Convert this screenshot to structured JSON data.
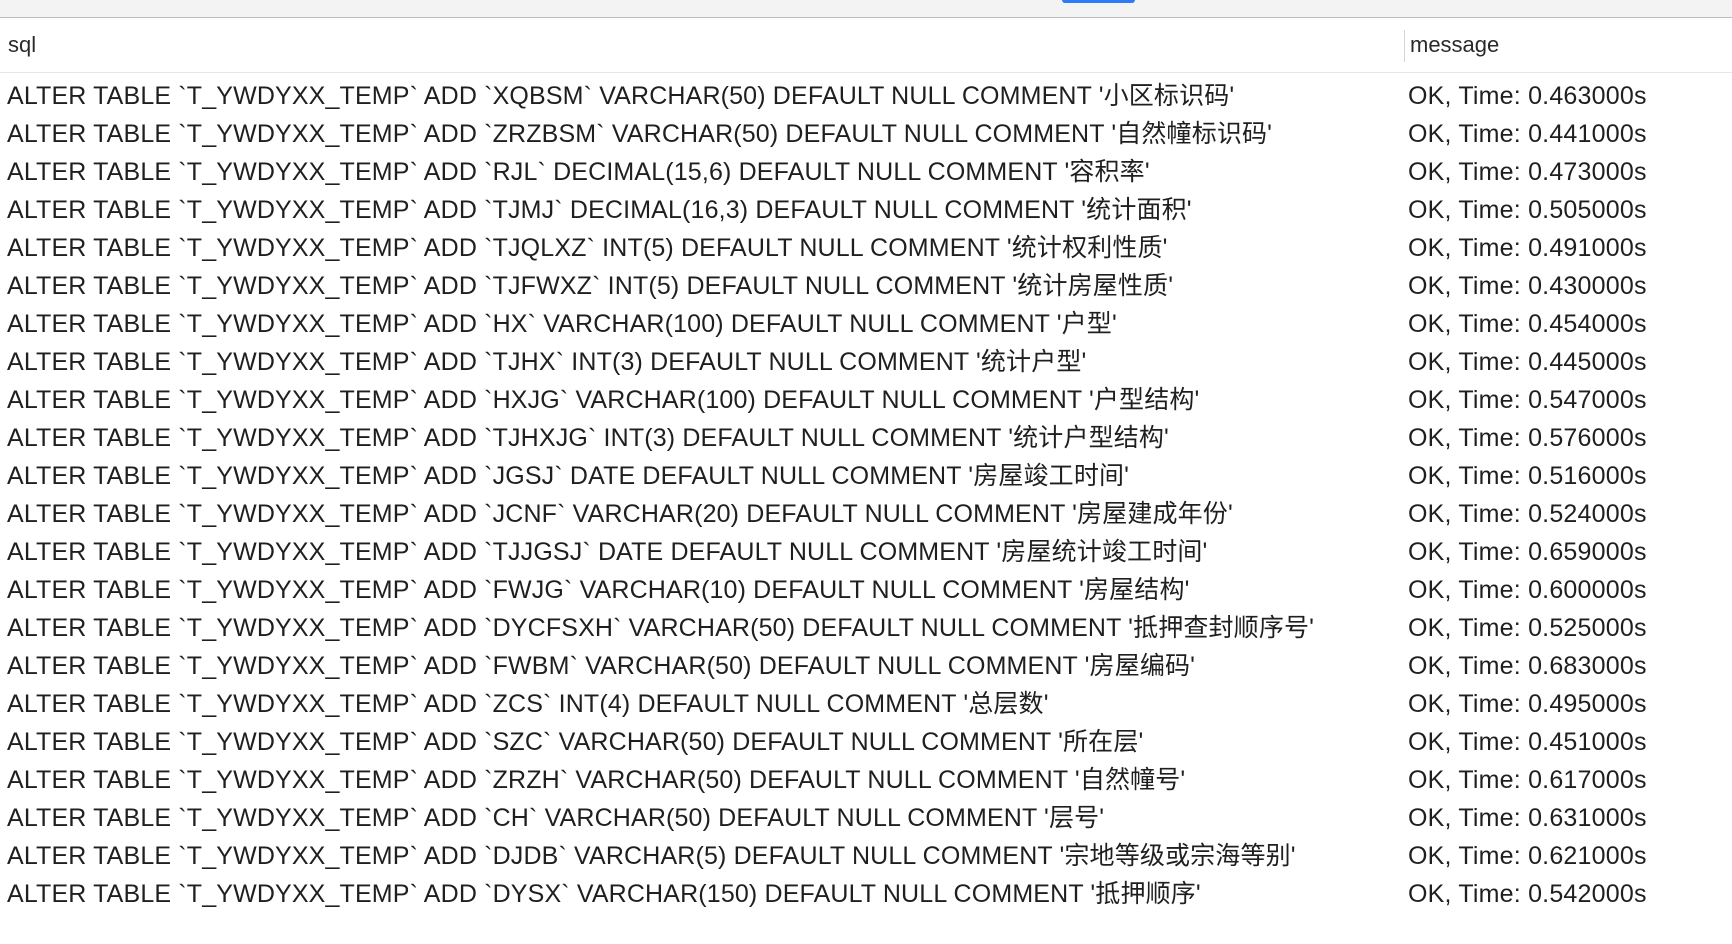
{
  "columns": {
    "sql": "sql",
    "message": "message"
  },
  "rows": [
    {
      "sql": "ALTER TABLE `T_YWDYXX_TEMP` ADD `XQBSM` VARCHAR(50) DEFAULT NULL COMMENT '小区标识码'",
      "message": "OK, Time: 0.463000s"
    },
    {
      "sql": "ALTER TABLE `T_YWDYXX_TEMP` ADD `ZRZBSM` VARCHAR(50) DEFAULT NULL COMMENT '自然幢标识码'",
      "message": "OK, Time: 0.441000s"
    },
    {
      "sql": "ALTER TABLE `T_YWDYXX_TEMP` ADD `RJL` DECIMAL(15,6) DEFAULT NULL COMMENT '容积率'",
      "message": "OK, Time: 0.473000s"
    },
    {
      "sql": "ALTER TABLE `T_YWDYXX_TEMP` ADD `TJMJ` DECIMAL(16,3) DEFAULT NULL COMMENT '统计面积'",
      "message": "OK, Time: 0.505000s"
    },
    {
      "sql": "ALTER TABLE `T_YWDYXX_TEMP` ADD `TJQLXZ` INT(5) DEFAULT NULL COMMENT '统计权利性质'",
      "message": "OK, Time: 0.491000s"
    },
    {
      "sql": "ALTER TABLE `T_YWDYXX_TEMP` ADD `TJFWXZ` INT(5) DEFAULT NULL COMMENT '统计房屋性质'",
      "message": "OK, Time: 0.430000s"
    },
    {
      "sql": "ALTER TABLE `T_YWDYXX_TEMP` ADD `HX` VARCHAR(100) DEFAULT NULL COMMENT '户型'",
      "message": "OK, Time: 0.454000s"
    },
    {
      "sql": "ALTER TABLE `T_YWDYXX_TEMP` ADD `TJHX` INT(3) DEFAULT NULL COMMENT '统计户型'",
      "message": "OK, Time: 0.445000s"
    },
    {
      "sql": "ALTER TABLE `T_YWDYXX_TEMP` ADD `HXJG` VARCHAR(100) DEFAULT NULL COMMENT '户型结构'",
      "message": "OK, Time: 0.547000s"
    },
    {
      "sql": "ALTER TABLE `T_YWDYXX_TEMP` ADD `TJHXJG` INT(3) DEFAULT NULL COMMENT '统计户型结构'",
      "message": "OK, Time: 0.576000s"
    },
    {
      "sql": "ALTER TABLE `T_YWDYXX_TEMP` ADD `JGSJ` DATE DEFAULT NULL COMMENT '房屋竣工时间'",
      "message": "OK, Time: 0.516000s"
    },
    {
      "sql": "ALTER TABLE `T_YWDYXX_TEMP` ADD `JCNF` VARCHAR(20) DEFAULT NULL COMMENT '房屋建成年份'",
      "message": "OK, Time: 0.524000s"
    },
    {
      "sql": "ALTER TABLE `T_YWDYXX_TEMP` ADD `TJJGSJ` DATE DEFAULT NULL COMMENT '房屋统计竣工时间'",
      "message": "OK, Time: 0.659000s"
    },
    {
      "sql": "ALTER TABLE `T_YWDYXX_TEMP` ADD `FWJG` VARCHAR(10) DEFAULT NULL COMMENT '房屋结构'",
      "message": "OK, Time: 0.600000s"
    },
    {
      "sql": "ALTER TABLE `T_YWDYXX_TEMP` ADD `DYCFSXH` VARCHAR(50) DEFAULT NULL COMMENT '抵押查封顺序号'",
      "message": "OK, Time: 0.525000s"
    },
    {
      "sql": "ALTER TABLE `T_YWDYXX_TEMP` ADD `FWBM` VARCHAR(50) DEFAULT NULL COMMENT '房屋编码'",
      "message": "OK, Time: 0.683000s"
    },
    {
      "sql": "ALTER TABLE `T_YWDYXX_TEMP` ADD `ZCS` INT(4) DEFAULT NULL COMMENT '总层数'",
      "message": "OK, Time: 0.495000s"
    },
    {
      "sql": "ALTER TABLE `T_YWDYXX_TEMP` ADD `SZC` VARCHAR(50) DEFAULT NULL COMMENT '所在层'",
      "message": "OK, Time: 0.451000s"
    },
    {
      "sql": "ALTER TABLE `T_YWDYXX_TEMP` ADD `ZRZH` VARCHAR(50) DEFAULT NULL COMMENT '自然幢号'",
      "message": "OK, Time: 0.617000s"
    },
    {
      "sql": "ALTER TABLE `T_YWDYXX_TEMP` ADD `CH` VARCHAR(50) DEFAULT NULL COMMENT '层号'",
      "message": "OK, Time: 0.631000s"
    },
    {
      "sql": "ALTER TABLE `T_YWDYXX_TEMP` ADD `DJDB` VARCHAR(5) DEFAULT NULL COMMENT '宗地等级或宗海等别'",
      "message": "OK, Time: 0.621000s"
    },
    {
      "sql": "ALTER TABLE `T_YWDYXX_TEMP` ADD `DYSX` VARCHAR(150) DEFAULT NULL COMMENT '抵押顺序'",
      "message": "OK, Time: 0.542000s"
    }
  ]
}
